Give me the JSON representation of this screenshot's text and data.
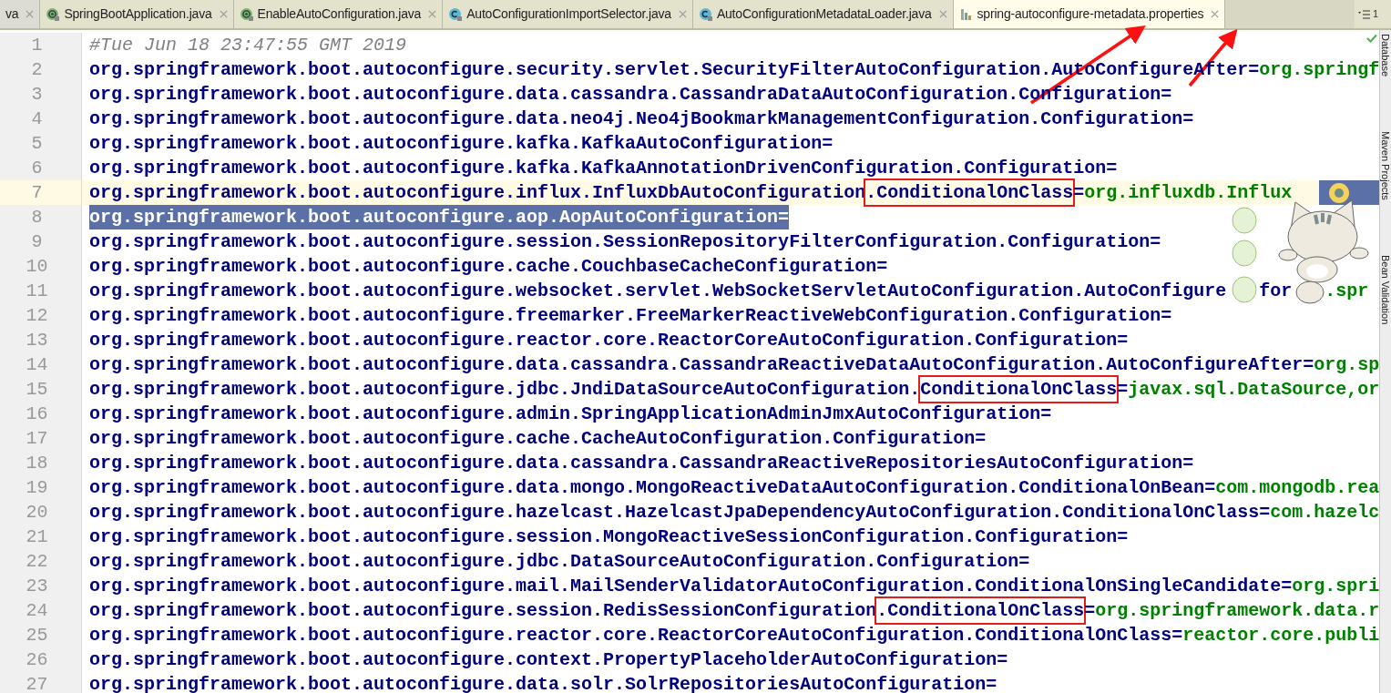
{
  "tabs": [
    {
      "label": "va",
      "kind": "plain",
      "selected": false
    },
    {
      "label": "SpringBootApplication.java",
      "kind": "annotation",
      "selected": false
    },
    {
      "label": "EnableAutoConfiguration.java",
      "kind": "annotation",
      "selected": false
    },
    {
      "label": "AutoConfigurationImportSelector.java",
      "kind": "class",
      "selected": false
    },
    {
      "label": "AutoConfigurationMetadataLoader.java",
      "kind": "class",
      "selected": false
    },
    {
      "label": "spring-autoconfigure-metadata.properties",
      "kind": "properties",
      "selected": true
    }
  ],
  "hidden_tabs_count": "1",
  "tool_windows": [
    {
      "label": "Database"
    },
    {
      "label": "Maven Projects"
    },
    {
      "label": "Bean Validation"
    }
  ],
  "lines": [
    {
      "number": "1",
      "current": false,
      "selected": false,
      "segments": [
        {
          "kind": "comment",
          "text": "#Tue Jun 18 23:47:55 GMT 2019",
          "boxed": false
        }
      ]
    },
    {
      "number": "2",
      "current": false,
      "selected": false,
      "segments": [
        {
          "kind": "key",
          "text": "org.springframework.boot.autoconfigure.security.servlet.SecurityFilterAutoConfiguration.AutoConfigureAfter=",
          "boxed": false
        },
        {
          "kind": "value",
          "text": "org.springf",
          "boxed": false
        }
      ]
    },
    {
      "number": "3",
      "current": false,
      "selected": false,
      "segments": [
        {
          "kind": "key",
          "text": "org.springframework.boot.autoconfigure.data.cassandra.CassandraDataAutoConfiguration.Configuration=",
          "boxed": false
        }
      ]
    },
    {
      "number": "4",
      "current": false,
      "selected": false,
      "segments": [
        {
          "kind": "key",
          "text": "org.springframework.boot.autoconfigure.data.neo4j.Neo4jBookmarkManagementConfiguration.Configuration=",
          "boxed": false
        }
      ]
    },
    {
      "number": "5",
      "current": false,
      "selected": false,
      "segments": [
        {
          "kind": "key",
          "text": "org.springframework.boot.autoconfigure.kafka.KafkaAutoConfiguration=",
          "boxed": false
        }
      ]
    },
    {
      "number": "6",
      "current": false,
      "selected": false,
      "segments": [
        {
          "kind": "key",
          "text": "org.springframework.boot.autoconfigure.kafka.KafkaAnnotationDrivenConfiguration.Configuration=",
          "boxed": false
        }
      ]
    },
    {
      "number": "7",
      "current": true,
      "selected": false,
      "segments": [
        {
          "kind": "key",
          "text": "org.springframework.boot.autoconfigure.influx.InfluxDbAutoConfiguration",
          "boxed": false
        },
        {
          "kind": "key",
          "text": ".ConditionalOnClass",
          "boxed": true
        },
        {
          "kind": "key",
          "text": "=",
          "boxed": false
        },
        {
          "kind": "value",
          "text": "org.influxdb.Influx",
          "boxed": false
        },
        {
          "kind": "selection"
        }
      ]
    },
    {
      "number": "8",
      "current": false,
      "selected": true,
      "segments": [
        {
          "kind": "key",
          "text": "org.springframework.boot.autoconfigure.aop.AopAutoConfiguration=",
          "boxed": false
        }
      ]
    },
    {
      "number": "9",
      "current": false,
      "selected": false,
      "segments": [
        {
          "kind": "key",
          "text": "org.springframework.boot.autoconfigure.session.SessionRepositoryFilterConfiguration.Configuration=",
          "boxed": false
        }
      ]
    },
    {
      "number": "10",
      "current": false,
      "selected": false,
      "segments": [
        {
          "kind": "key",
          "text": "org.springframework.boot.autoconfigure.cache.CouchbaseCacheConfiguration=",
          "boxed": false
        }
      ]
    },
    {
      "number": "11",
      "current": false,
      "selected": false,
      "segments": [
        {
          "kind": "key",
          "text": "org.springframework.boot.autoconfigure.websocket.servlet.WebSocketServletAutoConfiguration.AutoConfigure",
          "boxed": false
        },
        {
          "kind": "covered"
        },
        {
          "kind": "key",
          "text": "for",
          "boxed": false
        },
        {
          "kind": "covered"
        },
        {
          "kind": "value",
          "text": ".spr",
          "boxed": false
        }
      ]
    },
    {
      "number": "12",
      "current": false,
      "selected": false,
      "segments": [
        {
          "kind": "key",
          "text": "org.springframework.boot.autoconfigure.freemarker.FreeMarkerReactiveWebConfiguration.Configuration=",
          "boxed": false
        }
      ]
    },
    {
      "number": "13",
      "current": false,
      "selected": false,
      "segments": [
        {
          "kind": "key",
          "text": "org.springframework.boot.autoconfigure.reactor.core.ReactorCoreAutoConfiguration.Configuration=",
          "boxed": false
        }
      ]
    },
    {
      "number": "14",
      "current": false,
      "selected": false,
      "segments": [
        {
          "kind": "key",
          "text": "org.springframework.boot.autoconfigure.data.cassandra.CassandraReactiveDataAutoConfiguration.AutoConfigureAfter=",
          "boxed": false
        },
        {
          "kind": "value",
          "text": "org.sp",
          "boxed": false
        }
      ]
    },
    {
      "number": "15",
      "current": false,
      "selected": false,
      "segments": [
        {
          "kind": "key",
          "text": "org.springframework.boot.autoconfigure.jdbc.JndiDataSourceAutoConfiguration.",
          "boxed": false
        },
        {
          "kind": "key",
          "text": "ConditionalOnClass",
          "boxed": true
        },
        {
          "kind": "key",
          "text": "=",
          "boxed": false
        },
        {
          "kind": "value",
          "text": "javax.sql.DataSource,or",
          "boxed": false
        }
      ]
    },
    {
      "number": "16",
      "current": false,
      "selected": false,
      "segments": [
        {
          "kind": "key",
          "text": "org.springframework.boot.autoconfigure.admin.SpringApplicationAdminJmxAutoConfiguration=",
          "boxed": false
        }
      ]
    },
    {
      "number": "17",
      "current": false,
      "selected": false,
      "segments": [
        {
          "kind": "key",
          "text": "org.springframework.boot.autoconfigure.cache.CacheAutoConfiguration.Configuration=",
          "boxed": false
        }
      ]
    },
    {
      "number": "18",
      "current": false,
      "selected": false,
      "segments": [
        {
          "kind": "key",
          "text": "org.springframework.boot.autoconfigure.data.cassandra.CassandraReactiveRepositoriesAutoConfiguration=",
          "boxed": false
        }
      ]
    },
    {
      "number": "19",
      "current": false,
      "selected": false,
      "segments": [
        {
          "kind": "key",
          "text": "org.springframework.boot.autoconfigure.data.mongo.MongoReactiveDataAutoConfiguration.ConditionalOnBean=",
          "boxed": false
        },
        {
          "kind": "value",
          "text": "com.mongodb.rea",
          "boxed": false
        }
      ]
    },
    {
      "number": "20",
      "current": false,
      "selected": false,
      "segments": [
        {
          "kind": "key",
          "text": "org.springframework.boot.autoconfigure.hazelcast.HazelcastJpaDependencyAutoConfiguration.ConditionalOnClass=",
          "boxed": false
        },
        {
          "kind": "value",
          "text": "com.hazelc",
          "boxed": false
        }
      ]
    },
    {
      "number": "21",
      "current": false,
      "selected": false,
      "segments": [
        {
          "kind": "key",
          "text": "org.springframework.boot.autoconfigure.session.MongoReactiveSessionConfiguration.Configuration=",
          "boxed": false
        }
      ]
    },
    {
      "number": "22",
      "current": false,
      "selected": false,
      "segments": [
        {
          "kind": "key",
          "text": "org.springframework.boot.autoconfigure.jdbc.DataSourceAutoConfiguration.Configuration=",
          "boxed": false
        }
      ]
    },
    {
      "number": "23",
      "current": false,
      "selected": false,
      "segments": [
        {
          "kind": "key",
          "text": "org.springframework.boot.autoconfigure.mail.MailSenderValidatorAutoConfiguration.ConditionalOnSingleCandidate=",
          "boxed": false
        },
        {
          "kind": "value",
          "text": "org.spri",
          "boxed": false
        }
      ]
    },
    {
      "number": "24",
      "current": false,
      "selected": false,
      "segments": [
        {
          "kind": "key",
          "text": "org.springframework.boot.autoconfigure.session.RedisSessionConfiguration",
          "boxed": false
        },
        {
          "kind": "key",
          "text": ".ConditionalOnClass",
          "boxed": true
        },
        {
          "kind": "key",
          "text": "=",
          "boxed": false
        },
        {
          "kind": "value",
          "text": "org.springframework.data.r",
          "boxed": false
        }
      ]
    },
    {
      "number": "25",
      "current": false,
      "selected": false,
      "segments": [
        {
          "kind": "key",
          "text": "org.springframework.boot.autoconfigure.reactor.core.ReactorCoreAutoConfiguration.ConditionalOnClass=",
          "boxed": false
        },
        {
          "kind": "value",
          "text": "reactor.core.publi",
          "boxed": false
        }
      ]
    },
    {
      "number": "26",
      "current": false,
      "selected": false,
      "segments": [
        {
          "kind": "key",
          "text": "org.springframework.boot.autoconfigure.context.PropertyPlaceholderAutoConfiguration=",
          "boxed": false
        }
      ]
    },
    {
      "number": "27",
      "current": false,
      "selected": false,
      "segments": [
        {
          "kind": "key",
          "text": "org.springframework.boot.autoconfigure.data.solr.SolrRepositoriesAutoConfiguration=",
          "boxed": false
        }
      ]
    }
  ],
  "annotation_arrows": [
    {
      "kind": "arrow"
    },
    {
      "kind": "arrow"
    }
  ],
  "overlay": {
    "kind": "cat-sticker"
  }
}
